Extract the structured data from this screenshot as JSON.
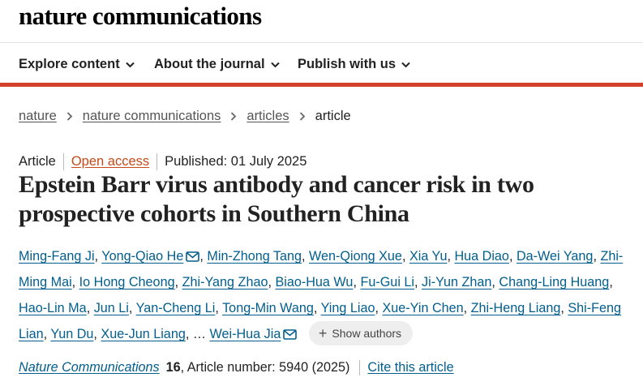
{
  "site": {
    "logo": "nature communications"
  },
  "nav": {
    "items": [
      {
        "label": "Explore content"
      },
      {
        "label": "About the journal"
      },
      {
        "label": "Publish with us"
      }
    ]
  },
  "breadcrumb": [
    "nature",
    "nature communications",
    "articles",
    "article"
  ],
  "article": {
    "type": "Article",
    "access": "Open access",
    "published": "Published: 01 July 2025",
    "title": "Epstein Barr virus antibody and cancer risk in two prospective cohorts in Southern China",
    "authors": [
      "Ming-Fang Ji",
      "Yong-Qiao He",
      "Min-Zhong Tang",
      "Wen-Qiong Xue",
      "Xia Yu",
      "Hua Diao",
      "Da-Wei Yang",
      "Zhi-Ming Mai",
      "Io Hong Cheong",
      "Zhi-Yang Zhao",
      "Biao-Hua Wu",
      "Fu-Gui Li",
      "Ji-Yun Zhan",
      "Chang-Ling Huang",
      "Hao-Lin Ma",
      "Jun Li",
      "Yan-Cheng Li",
      "Tong-Min Wang",
      "Ying Liao",
      "Xue-Yin Chen",
      "Zhi-Heng Liang",
      "Shi-Feng Lian",
      "Yun Du",
      "Xue-Jun Liang",
      "Wei-Hua Jia"
    ],
    "ellipsis": "…",
    "show_authors": "Show authors",
    "journal": "Nature Communications",
    "volume": "16",
    "article_number": ", Article number: 5940 (2025)",
    "cite": "Cite this article"
  },
  "colors": {
    "accent": "#d33f2a",
    "link": "#025e8d",
    "open_access": "#c64a1a"
  }
}
